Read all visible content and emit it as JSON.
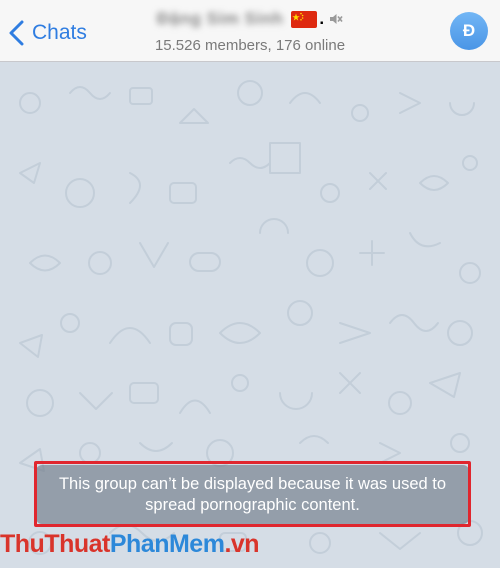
{
  "header": {
    "back_label": "Chats",
    "group_name": "Đặng Sim Sinh",
    "member_status": "15.526 members, 176 online",
    "avatar_initial": "Đ",
    "flag_icon": "china-flag-icon",
    "mute_icon": "speaker-muted-icon"
  },
  "chat": {
    "notice_text": "This group can’t be displayed because it was used to spread pornographic content.",
    "highlight_color": "#e0262e"
  },
  "watermark": {
    "part1": "ThuThuat",
    "part2": "PhanMem",
    "part3": ".vn"
  },
  "colors": {
    "accent": "#2f7de1",
    "background": "#d5dde6"
  }
}
